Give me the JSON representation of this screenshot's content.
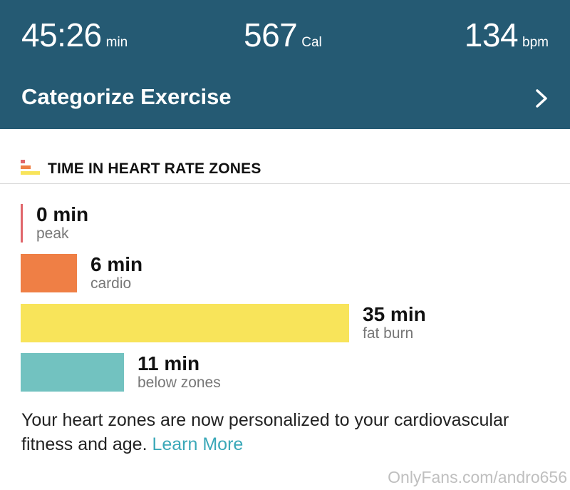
{
  "header": {
    "duration": {
      "value": "45:26",
      "unit": "min"
    },
    "calories": {
      "value": "567",
      "unit": "Cal"
    },
    "heart_rate": {
      "value": "134",
      "unit": "bpm"
    },
    "categorize_label": "Categorize Exercise",
    "background_color": "#255a73",
    "chevron_icon": "chevron-right-icon"
  },
  "section": {
    "title": "TIME IN HEART RATE ZONES",
    "icon": "heart-rate-zones-icon"
  },
  "zones": [
    {
      "minutes": 0,
      "minutes_text": "0 min",
      "label": "peak",
      "color": "#e0666b"
    },
    {
      "minutes": 6,
      "minutes_text": "6 min",
      "label": "cardio",
      "color": "#ef7f45"
    },
    {
      "minutes": 35,
      "minutes_text": "35 min",
      "label": "fat burn",
      "color": "#f8e45a"
    },
    {
      "minutes": 11,
      "minutes_text": "11 min",
      "label": "below zones",
      "color": "#72c2c0"
    }
  ],
  "footer": {
    "text": "Your heart zones are now personalized to your cardiovascular fitness and age.",
    "link_text": "Learn More",
    "link_color": "#3aa8b8"
  },
  "watermark": "OnlyFans.com/andro656"
}
